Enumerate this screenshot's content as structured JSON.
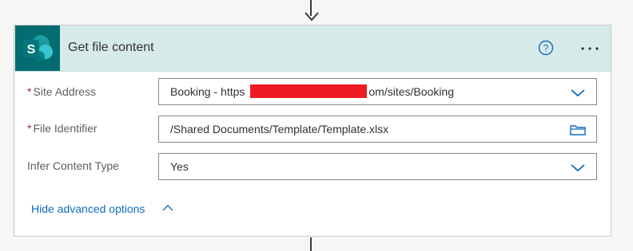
{
  "action": {
    "title": "Get file content",
    "icon": "sharepoint-icon",
    "help_icon": "help-icon",
    "more_icon": "more-options-icon",
    "accent_color": "#036c70"
  },
  "fields": [
    {
      "label": "Site Address",
      "required": "*",
      "value_prefix": "Booking - https",
      "value_suffix": "om/sites/Booking",
      "control": "dropdown",
      "icon": "chevron-down-icon"
    },
    {
      "label": "File Identifier",
      "required": "*",
      "value": "/Shared Documents/Template/Template.xlsx",
      "control": "file-picker",
      "icon": "folder-icon"
    },
    {
      "label": "Infer Content Type",
      "value": "Yes",
      "control": "dropdown",
      "icon": "chevron-down-icon"
    }
  ],
  "advanced": {
    "label": "Hide advanced options",
    "icon": "chevron-up-icon"
  }
}
